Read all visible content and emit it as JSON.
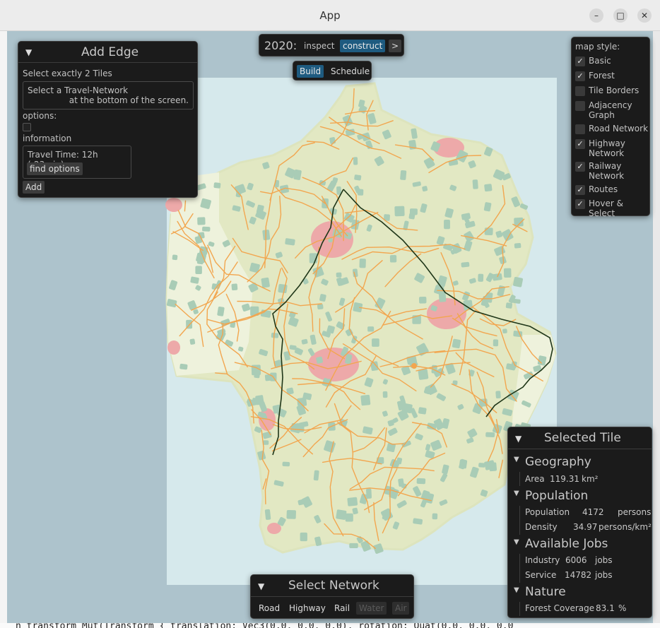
{
  "window": {
    "title": "App",
    "buttons": {
      "minimize": "–",
      "maximize": "□",
      "close": "✕"
    }
  },
  "background_code": "n transform   Mut(Transform { translation: Vec3(0.0, 0.0, 0.0), rotation: Quat(0.0, 0.0, 0.0",
  "topbar": {
    "year": "2020:",
    "mode_inspect": "inspect",
    "mode_construct": "construct",
    "next": ">",
    "tab_build": "Build",
    "tab_schedule": "Schedule"
  },
  "add_edge": {
    "title": "Add Edge",
    "instruction": "Select exactly 2 Tiles",
    "hint_line1": "Select a Travel-Network",
    "hint_line2": "at the bottom of the screen.",
    "options_label": "options:",
    "information_label": "information",
    "travel_time": "Travel Time: 12h (-23min)",
    "find_options": "find options",
    "add": "Add"
  },
  "map_style": {
    "title": "map style:",
    "items": [
      {
        "label": "Basic",
        "checked": true
      },
      {
        "label": "Forest",
        "checked": true
      },
      {
        "label": "Tile Borders",
        "checked": false
      },
      {
        "label": "Adjacency",
        "label2": "Graph",
        "checked": false
      },
      {
        "label": "Road Network",
        "checked": false
      },
      {
        "label": "Highway",
        "label2": "Network",
        "checked": true
      },
      {
        "label": "Railway",
        "label2": "Network",
        "checked": true
      },
      {
        "label": "Routes",
        "checked": true
      },
      {
        "label": "Hover & Select",
        "checked": true
      }
    ]
  },
  "selected_tile": {
    "title": "Selected Tile",
    "geography": {
      "header": "Geography",
      "area_label": "Area",
      "area_value": "119.31",
      "area_unit": "km²"
    },
    "population": {
      "header": "Population",
      "pop_label": "Population",
      "pop_value": "4172",
      "pop_unit": "persons",
      "density_label": "Density",
      "density_value": "34.97",
      "density_unit": "persons/km²"
    },
    "jobs": {
      "header": "Available Jobs",
      "industry_label": "Industry",
      "industry_value": "6006",
      "industry_unit": "jobs",
      "service_label": "Service",
      "service_value": "14782",
      "service_unit": "jobs"
    },
    "nature": {
      "header": "Nature",
      "forest_label": "Forest Coverage",
      "forest_value": "83.1",
      "forest_unit": "%"
    }
  },
  "select_network": {
    "title": "Select Network",
    "options": [
      {
        "label": "Road",
        "enabled": true
      },
      {
        "label": "Highway",
        "enabled": true
      },
      {
        "label": "Rail",
        "enabled": true
      },
      {
        "label": "Water",
        "enabled": false
      },
      {
        "label": "Air",
        "enabled": false
      }
    ]
  },
  "colors": {
    "water": "#d6e9ec",
    "deep_water": "#adc3cc",
    "land": "#e2e8c3",
    "light_land": "#eef2dc",
    "forest": "#a9ccb6",
    "urban": "#eda9a9",
    "road": "#f2a64f",
    "rail": "#1f3618",
    "accent": "#1e5b80",
    "panel": "#1b1b1b"
  }
}
